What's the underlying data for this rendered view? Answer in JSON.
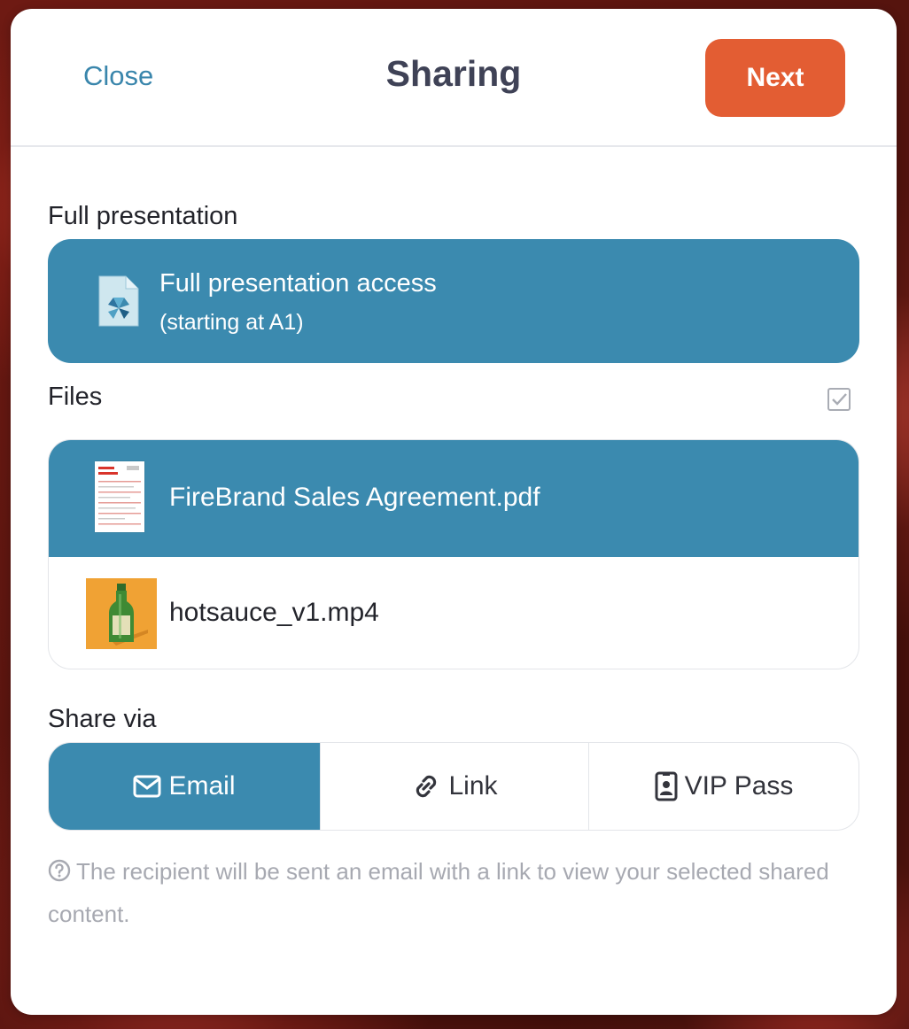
{
  "header": {
    "close_label": "Close",
    "title": "Sharing",
    "next_label": "Next"
  },
  "full_presentation": {
    "section_label": "Full presentation",
    "card_title": "Full presentation access",
    "card_subtitle": "(starting at A1)",
    "icon": "presentation-file-icon",
    "selected": true
  },
  "files": {
    "section_label": "Files",
    "select_all_checked": true,
    "items": [
      {
        "name": "FireBrand Sales Agreement.pdf",
        "thumbnail": "pdf-document-thumbnail",
        "selected": true
      },
      {
        "name": "hotsauce_v1.mp4",
        "thumbnail": "hot-sauce-bottle-thumbnail",
        "selected": false
      }
    ]
  },
  "share_via": {
    "section_label": "Share via",
    "options": [
      {
        "label": "Email",
        "icon": "envelope-icon",
        "active": true
      },
      {
        "label": "Link",
        "icon": "link-icon",
        "active": false
      },
      {
        "label": "VIP Pass",
        "icon": "id-badge-icon",
        "active": false
      }
    ]
  },
  "help_text": "The recipient will be sent an email with a link to view your selected shared content.",
  "colors": {
    "accent_blue": "#3b8aaf",
    "next_orange": "#e35d33",
    "title_text": "#3f4256",
    "help_text": "#a7a9b1"
  }
}
